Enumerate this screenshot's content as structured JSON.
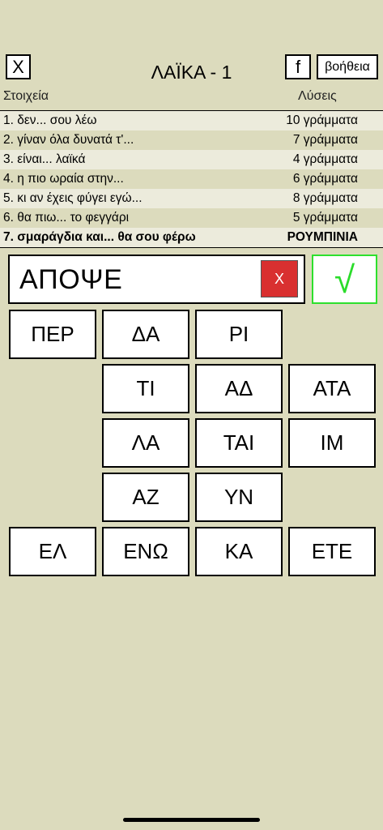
{
  "header": {
    "close_label": "X",
    "title": "ΛΑΪΚΑ - 1",
    "facebook_label": "f",
    "help_label": "βοήθεια"
  },
  "columns": {
    "left": "Στοιχεία",
    "right": "Λύσεις"
  },
  "clues": [
    {
      "q": "1. δεν... σου λέω",
      "a": "10 γράμματα"
    },
    {
      "q": "2. γίναν όλα δυνατά τ'...",
      "a": "7 γράμματα"
    },
    {
      "q": "3. είναι... λαϊκά",
      "a": "4 γράμματα"
    },
    {
      "q": "4. η πιο ωραία στην...",
      "a": "6 γράμματα"
    },
    {
      "q": "5. κι αν έχεις φύγει εγώ...",
      "a": "8 γράμματα"
    },
    {
      "q": "6. θα πιω... το φεγγάρι",
      "a": "5 γράμματα"
    },
    {
      "q": "7. σμαράγδια και... θα σου φέρω",
      "a": "ΡΟΥΜΠΙΝΙΑ"
    }
  ],
  "answer": {
    "value": "ΑΠΟΨΕ",
    "clear_label": "X",
    "check_label": "√"
  },
  "tiles": {
    "r1c1": "ΠΕΡ",
    "r1c2": "ΔΑ",
    "r1c3": "ΡΙ",
    "r2c2": "ΤΙ",
    "r2c3": "ΑΔ",
    "r2c4": "ΑΤΑ",
    "r3c2": "ΛΑ",
    "r3c3": "ΤΑΙ",
    "r3c4": "ΙΜ",
    "r4c2": "ΑΖ",
    "r4c3": "ΥΝ",
    "r5c1": "ΕΛ",
    "r5c2": "ΕΝΩ",
    "r5c3": "ΚΑ",
    "r5c4": "ΕΤΕ"
  }
}
